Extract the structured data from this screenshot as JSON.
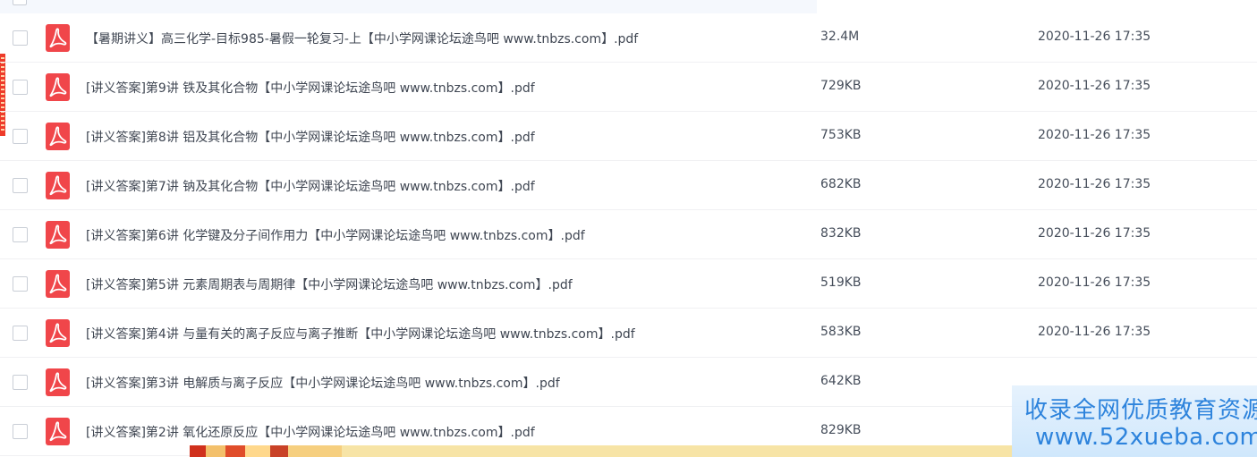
{
  "files": [
    {
      "name": "【暑期讲义】高三化学-目标985-暑假一轮复习-上【中小学网课论坛途鸟吧 www.tnbzs.com】.pdf",
      "size": "32.4M",
      "time": "2020-11-26 17:35",
      "icon": "pdf-icon"
    },
    {
      "name": "[讲义答案]第9讲 铁及其化合物【中小学网课论坛途鸟吧 www.tnbzs.com】.pdf",
      "size": "729KB",
      "time": "2020-11-26 17:35",
      "icon": "pdf-icon"
    },
    {
      "name": "[讲义答案]第8讲 铝及其化合物【中小学网课论坛途鸟吧 www.tnbzs.com】.pdf",
      "size": "753KB",
      "time": "2020-11-26 17:35",
      "icon": "pdf-icon"
    },
    {
      "name": "[讲义答案]第7讲 钠及其化合物【中小学网课论坛途鸟吧 www.tnbzs.com】.pdf",
      "size": "682KB",
      "time": "2020-11-26 17:35",
      "icon": "pdf-icon"
    },
    {
      "name": "[讲义答案]第6讲 化学键及分子间作用力【中小学网课论坛途鸟吧 www.tnbzs.com】.pdf",
      "size": "832KB",
      "time": "2020-11-26 17:35",
      "icon": "pdf-icon"
    },
    {
      "name": "[讲义答案]第5讲 元素周期表与周期律【中小学网课论坛途鸟吧 www.tnbzs.com】.pdf",
      "size": "519KB",
      "time": "2020-11-26 17:35",
      "icon": "pdf-icon"
    },
    {
      "name": "[讲义答案]第4讲 与量有关的离子反应与离子推断【中小学网课论坛途鸟吧 www.tnbzs.com】.pdf",
      "size": "583KB",
      "time": "2020-11-26 17:35",
      "icon": "pdf-icon"
    },
    {
      "name": "[讲义答案]第3讲 电解质与离子反应【中小学网课论坛途鸟吧 www.tnbzs.com】.pdf",
      "size": "642KB",
      "time": "",
      "icon": "pdf-icon"
    },
    {
      "name": "[讲义答案]第2讲 氧化还原反应【中小学网课论坛途鸟吧 www.tnbzs.com】.pdf",
      "size": "829KB",
      "time": "",
      "icon": "pdf-icon"
    }
  ],
  "watermark": {
    "line1": "收录全网优质教育资源",
    "line2": "www.52xueba.com"
  },
  "colors": {
    "pdf_icon": "#f0464a",
    "watermark_text": "#2d83dc"
  }
}
